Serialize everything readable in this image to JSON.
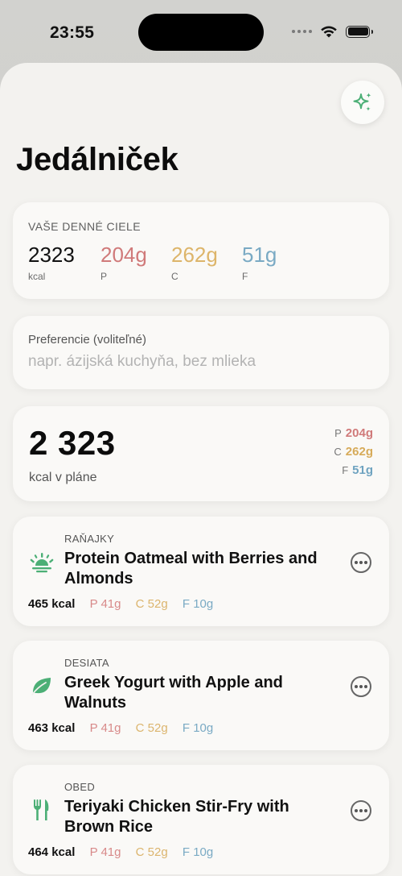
{
  "status_bar": {
    "time": "23:55",
    "icons": [
      "signal-icon",
      "wifi-icon",
      "battery-icon"
    ]
  },
  "header": {
    "title": "Jedálniček",
    "action_icon": "sparkles-icon"
  },
  "goals": {
    "heading": "VAŠE DENNÉ CIELE",
    "kcal_value": "2323",
    "kcal_unit": "kcal",
    "protein_value": "204g",
    "protein_unit": "P",
    "carbs_value": "262g",
    "carbs_unit": "C",
    "fat_value": "51g",
    "fat_unit": "F"
  },
  "preferences": {
    "label": "Preferencie (voliteľné)",
    "value": "",
    "placeholder": "napr. ázijská kuchyňa, bez mlieka"
  },
  "plan_total": {
    "kcal": "2 323",
    "label": "kcal v pláne",
    "p_label": "P",
    "p_value": "204g",
    "c_label": "C",
    "c_value": "262g",
    "f_label": "F",
    "f_value": "51g"
  },
  "meals": [
    {
      "type": "RAŇAJKY",
      "icon": "sunrise-icon",
      "name": "Protein Oatmeal with Berries and Almonds",
      "kcal": "465 kcal",
      "p": "P 41g",
      "c": "C 52g",
      "f": "F 10g"
    },
    {
      "type": "DESIATA",
      "icon": "leaf-icon",
      "name": "Greek Yogurt with Apple and Walnuts",
      "kcal": "463 kcal",
      "p": "P 41g",
      "c": "C 52g",
      "f": "F 10g"
    },
    {
      "type": "OBED",
      "icon": "fork-knife-icon",
      "name": "Teriyaki Chicken Stir-Fry with Brown Rice",
      "kcal": "464 kcal",
      "p": "P 41g",
      "c": "C 52g",
      "f": "F 10g"
    }
  ],
  "colors": {
    "accent_green": "#4caf76",
    "protein": "#d07a7a",
    "carbs": "#ddb56a",
    "fat": "#7aaac4"
  }
}
